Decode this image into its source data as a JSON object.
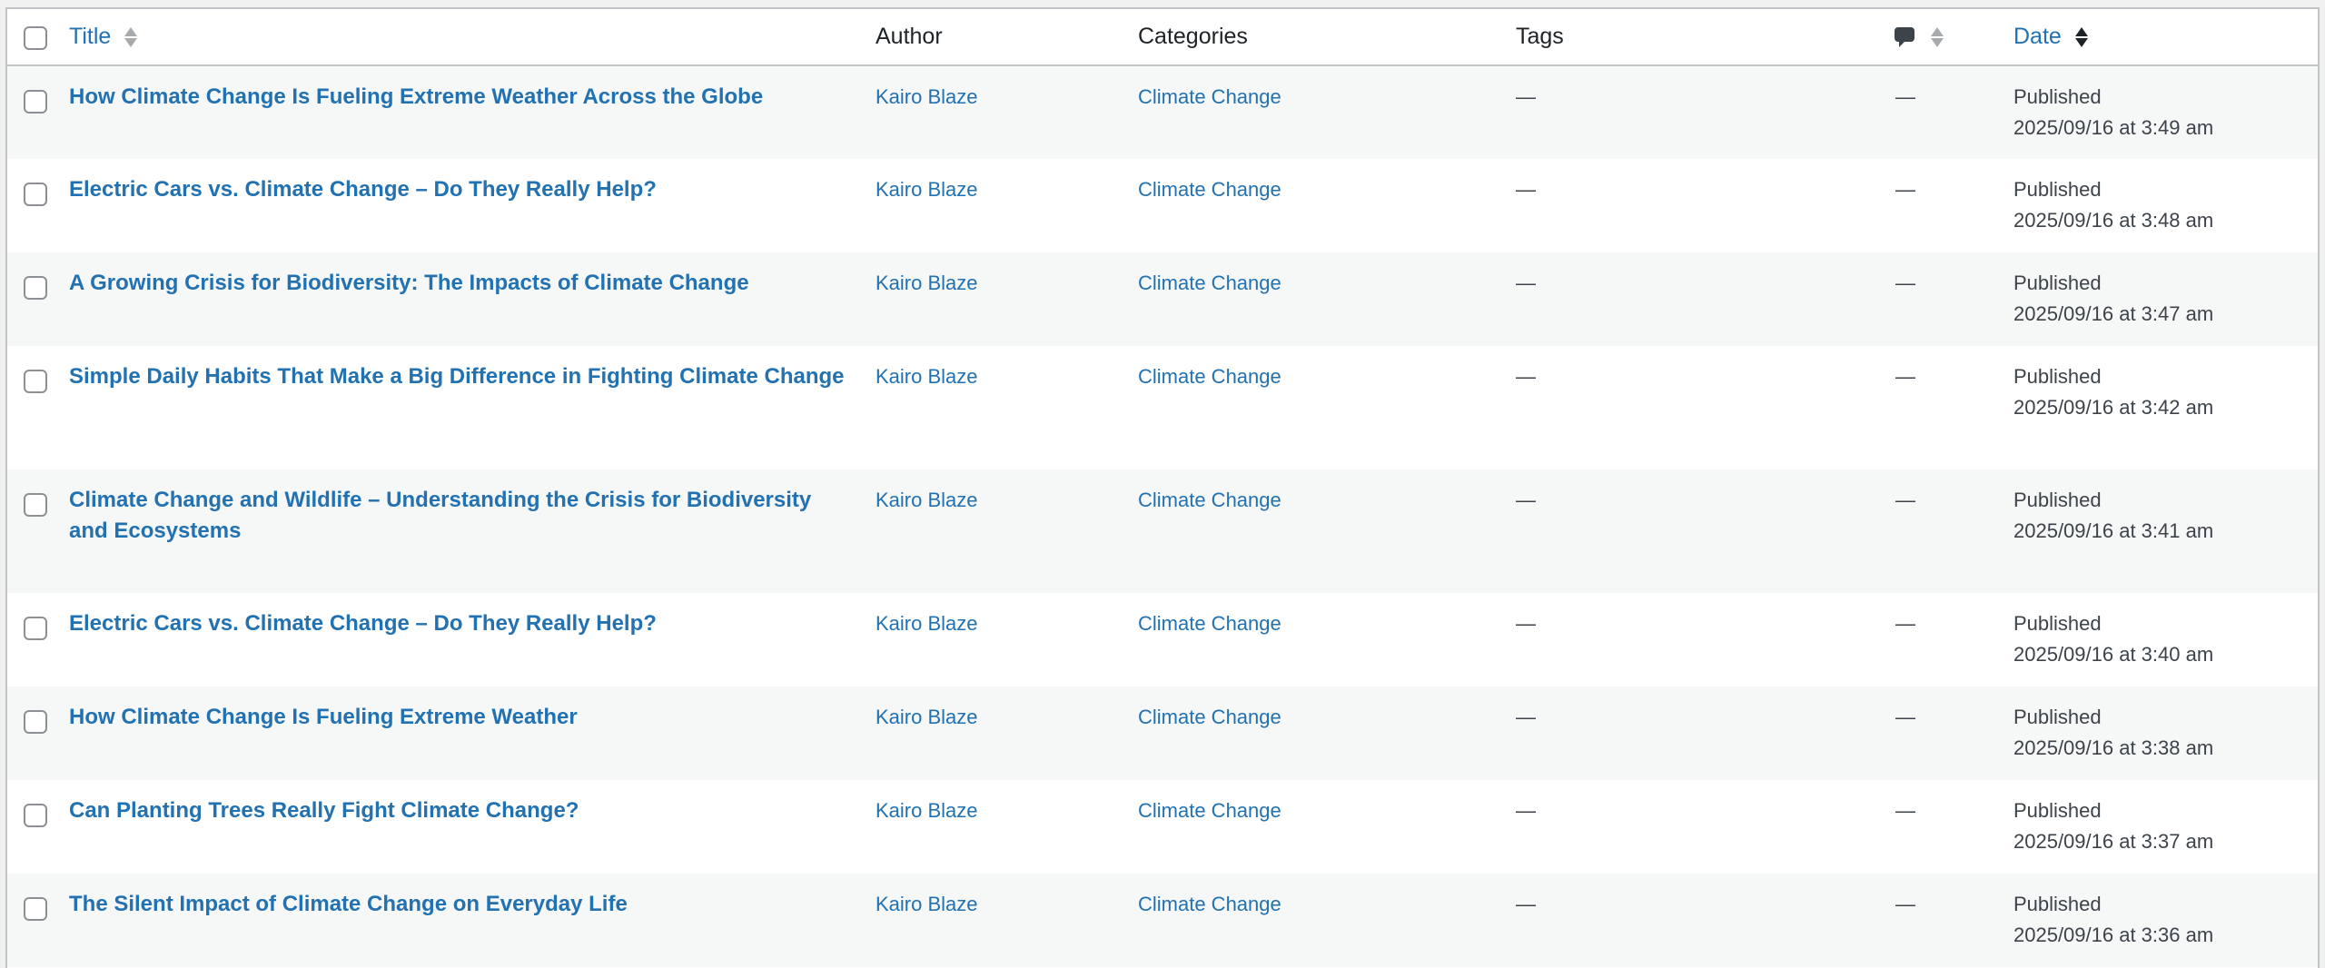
{
  "header": {
    "title": "Title",
    "author": "Author",
    "categories": "Categories",
    "tags": "Tags",
    "date": "Date"
  },
  "icons": {
    "comments": "comment-bubble-icon",
    "sort": "sort-arrows-icon"
  },
  "colors": {
    "link": "#2271b1",
    "row_alt": "#f6f7f7",
    "border": "#c3c4c7"
  },
  "rows": [
    {
      "title": "How Climate Change Is Fueling Extreme Weather Across the Globe",
      "author": "Kairo Blaze",
      "category": "Climate Change",
      "tags": "—",
      "comments": "—",
      "status": "Published",
      "date": "2025/09/16 at 3:49 am"
    },
    {
      "title": "Electric Cars vs. Climate Change – Do They Really Help?",
      "author": "Kairo Blaze",
      "category": "Climate Change",
      "tags": "—",
      "comments": "—",
      "status": "Published",
      "date": "2025/09/16 at 3:48 am"
    },
    {
      "title": "A Growing Crisis for Biodiversity: The Impacts of Climate Change",
      "author": "Kairo Blaze",
      "category": "Climate Change",
      "tags": "—",
      "comments": "—",
      "status": "Published",
      "date": "2025/09/16 at 3:47 am"
    },
    {
      "title": "Simple Daily Habits That Make a Big Difference in Fighting Climate Change",
      "author": "Kairo Blaze",
      "category": "Climate Change",
      "tags": "—",
      "comments": "—",
      "status": "Published",
      "date": "2025/09/16 at 3:42 am"
    },
    {
      "title": "Climate Change and Wildlife – Understanding the Crisis for Biodiversity and Ecosystems",
      "author": "Kairo Blaze",
      "category": "Climate Change",
      "tags": "—",
      "comments": "—",
      "status": "Published",
      "date": "2025/09/16 at 3:41 am"
    },
    {
      "title": "Electric Cars vs. Climate Change – Do They Really Help?",
      "author": "Kairo Blaze",
      "category": "Climate Change",
      "tags": "—",
      "comments": "—",
      "status": "Published",
      "date": "2025/09/16 at 3:40 am"
    },
    {
      "title": "How Climate Change Is Fueling Extreme Weather",
      "author": "Kairo Blaze",
      "category": "Climate Change",
      "tags": "—",
      "comments": "—",
      "status": "Published",
      "date": "2025/09/16 at 3:38 am"
    },
    {
      "title": "Can Planting Trees Really Fight Climate Change?",
      "author": "Kairo Blaze",
      "category": "Climate Change",
      "tags": "—",
      "comments": "—",
      "status": "Published",
      "date": "2025/09/16 at 3:37 am"
    },
    {
      "title": "The Silent Impact of Climate Change on Everyday Life",
      "author": "Kairo Blaze",
      "category": "Climate Change",
      "tags": "—",
      "comments": "—",
      "status": "Published",
      "date": "2025/09/16 at 3:36 am"
    }
  ]
}
